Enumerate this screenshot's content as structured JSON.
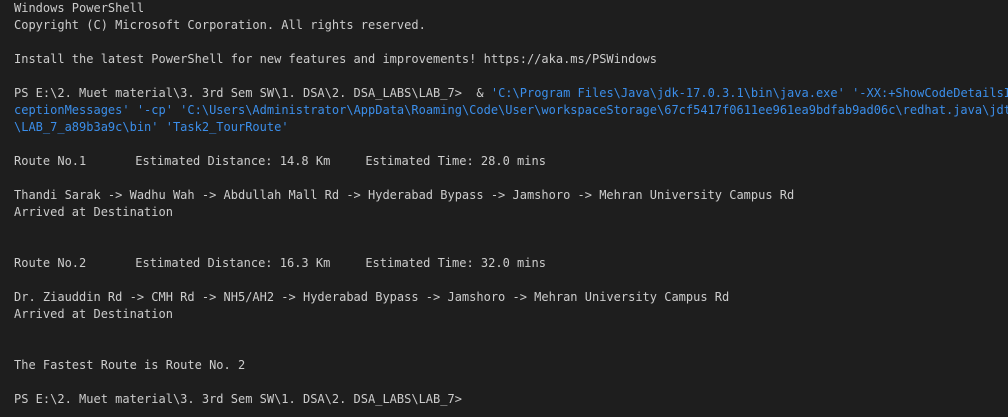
{
  "terminal": {
    "header": {
      "title": "Windows PowerShell",
      "copyright": "Copyright (C) Microsoft Corporation. All rights reserved.",
      "install_notice": "Install the latest PowerShell for new features and improvements! https://aka.ms/PSWindows"
    },
    "command": {
      "prompt": "PS E:\\2. Muet material\\3. 3rd Sem SW\\1. DSA\\2. DSA_LABS\\LAB_7> ",
      "amp": " & ",
      "java_path": "'C:\\Program Files\\Java\\jdk-17.0.3.1\\bin\\java.exe'",
      "arg1_part1": " '-XX:+ShowCodeDetailsInEx",
      "arg1_part2": "ceptionMessages'",
      "cp_flag": " '-cp'",
      "classpath_part1": " 'C:\\Users\\Administrator\\AppData\\Roaming\\Code\\User\\workspaceStorage\\67cf5417f0611ee961ea9bdfab9ad06c\\redhat.java\\jdt_ws",
      "classpath_part2": "\\LAB_7_a89b3a9c\\bin'",
      "main_class": " 'Task2_TourRoute'"
    },
    "routes": [
      {
        "label": "Route No.1",
        "distance": "Estimated Distance: 14.8 Km",
        "time": "Estimated Time: 28.0 mins",
        "path": "Thandi Sarak -> Wadhu Wah -> Abdullah Mall Rd -> Hyderabad Bypass -> Jamshoro -> Mehran University Campus Rd",
        "status": "Arrived at Destination"
      },
      {
        "label": "Route No.2",
        "distance": "Estimated Distance: 16.3 Km",
        "time": "Estimated Time: 32.0 mins",
        "path": "Dr. Ziauddin Rd -> CMH Rd -> NH5/AH2 -> Hyderabad Bypass -> Jamshoro -> Mehran University Campus Rd",
        "status": "Arrived at Destination"
      }
    ],
    "result": "The Fastest Route is Route No. 2",
    "final_prompt": "PS E:\\2. Muet material\\3. 3rd Sem SW\\1. DSA\\2. DSA_LABS\\LAB_7>"
  },
  "colors": {
    "background": "#1e1e1e",
    "text": "#cccccc",
    "argument": "#3b8eea"
  }
}
